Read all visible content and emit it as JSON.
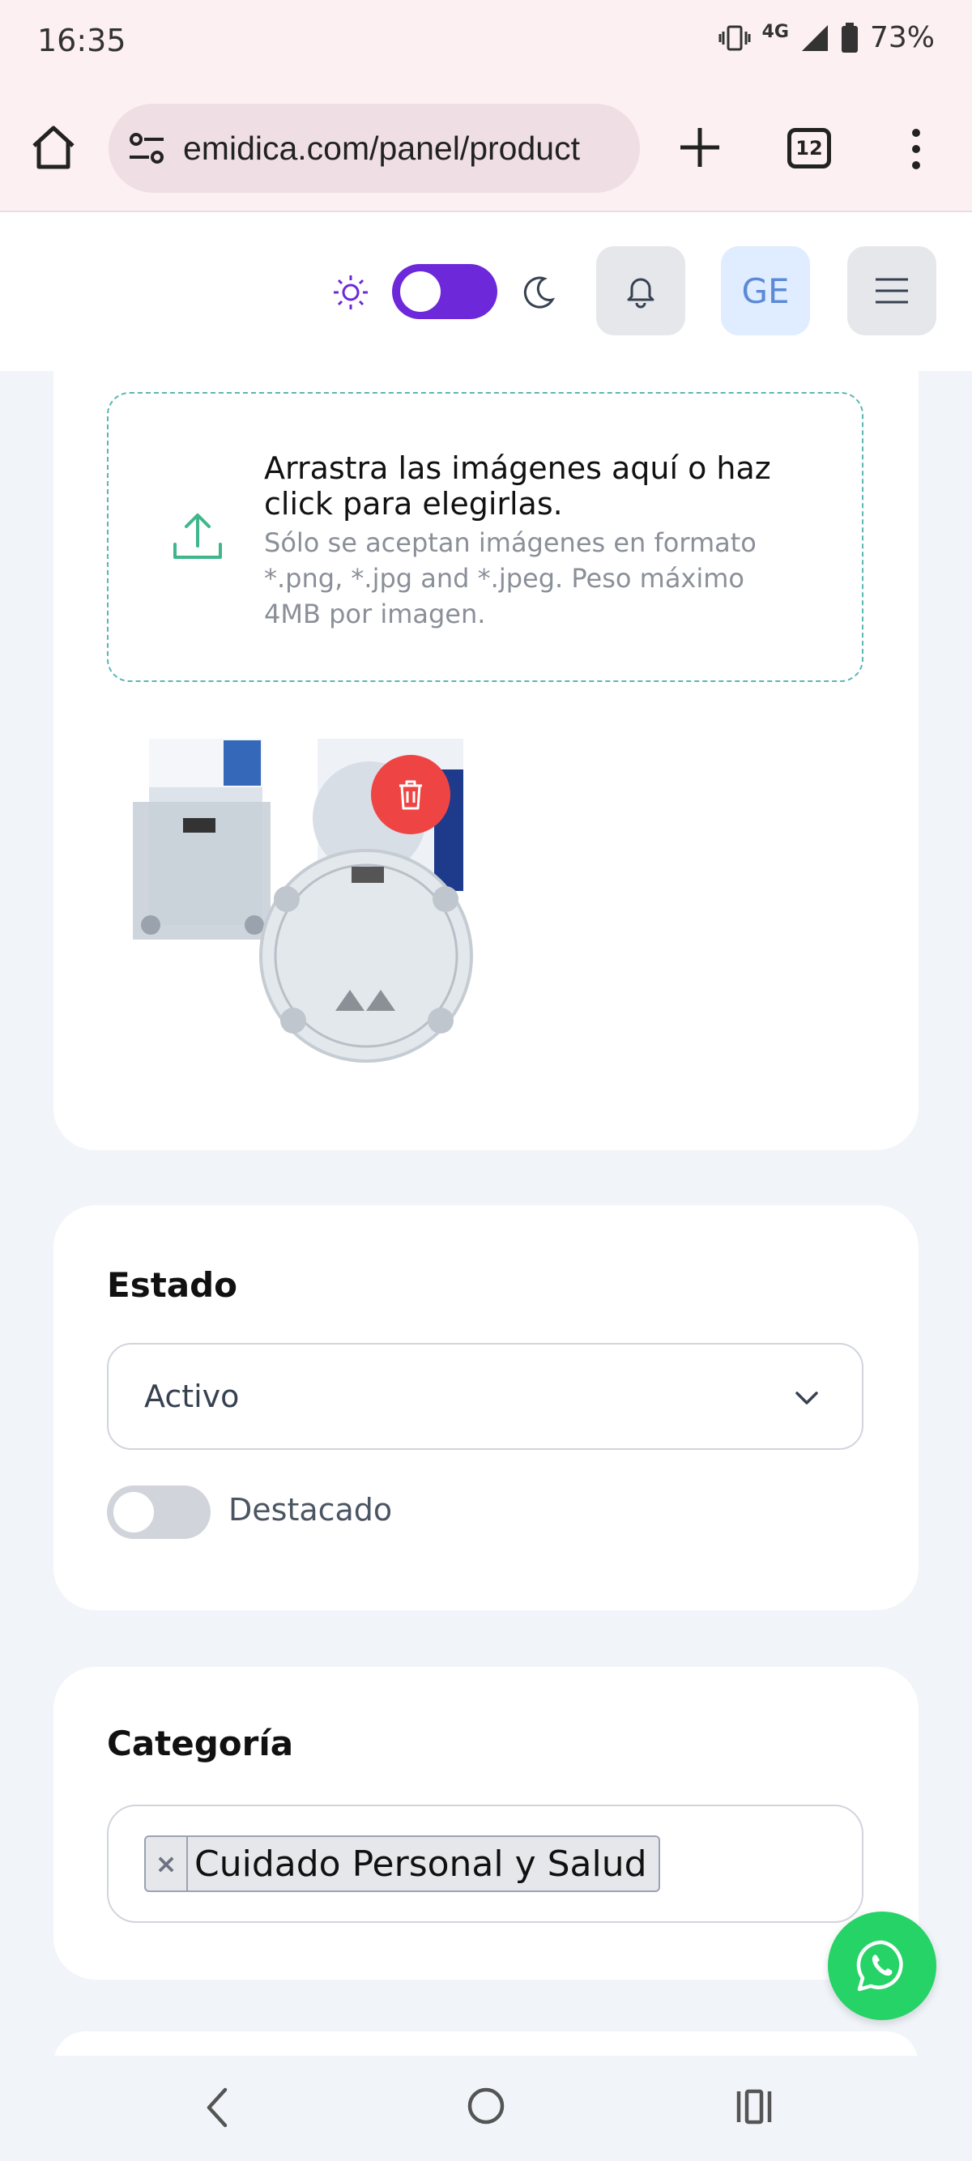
{
  "status_bar": {
    "time": "16:35",
    "network": "4G",
    "battery": "73%"
  },
  "browser": {
    "url": "emidica.com/panel/product",
    "tab_count": "12"
  },
  "header": {
    "avatar_initials": "GE",
    "theme_mode": "dark"
  },
  "images_section": {
    "dropzone_title": "Arrastra las imágenes aquí o haz click para elegirlas.",
    "dropzone_hint": "Sólo se aceptan imágenes en formato *.png, *.jpg and *.jpeg. Peso máximo 4MB por imagen."
  },
  "status_section": {
    "title": "Estado",
    "selected_status": "Activo",
    "featured_label": "Destacado",
    "featured_enabled": false
  },
  "category_section": {
    "title": "Categoría",
    "tags": [
      "Cuidado Personal y Salud"
    ]
  },
  "colors": {
    "accent": "#6d28d9",
    "delete": "#ef4444",
    "whatsapp": "#25d366",
    "dropzone_border": "#5cb6b4"
  }
}
